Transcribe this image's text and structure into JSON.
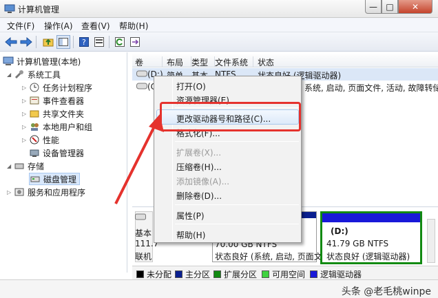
{
  "window": {
    "title": "计算机管理",
    "controls": {
      "minimize": "—",
      "maximize": "□",
      "close": "✕"
    }
  },
  "menu": [
    "文件(F)",
    "操作(A)",
    "查看(V)",
    "帮助(H)"
  ],
  "tree": {
    "root": "计算机管理(本地)",
    "system_tools": "系统工具",
    "system_children": [
      "任务计划程序",
      "事件查看器",
      "共享文件夹",
      "本地用户和组",
      "性能",
      "设备管理器"
    ],
    "storage": "存储",
    "disk_mgmt": "磁盘管理",
    "services": "服务和应用程序"
  },
  "columns": [
    "卷",
    "布局",
    "类型",
    "文件系统",
    "状态"
  ],
  "volumes": [
    {
      "vol": "(D:)",
      "layout": "简单",
      "type": "基本",
      "fs": "NTFS",
      "status": "状态良好 (逻辑驱动器)"
    },
    {
      "vol": "(C",
      "layout": "",
      "type": "",
      "fs": "",
      "status": "系统, 启动, 页面文件, 活动, 故障转储, 主"
    }
  ],
  "context_menu": {
    "items": [
      "打开(O)",
      "资源管理器(E)",
      "更改驱动器号和路径(C)...",
      "格式化(F)...",
      "扩展卷(X)...",
      "压缩卷(H)...",
      "添加镜像(A)...",
      "删除卷(D)...",
      "属性(P)",
      "帮助(H)"
    ],
    "disabled": [
      "扩展卷(X)...",
      "添加镜像(A)..."
    ]
  },
  "disk": {
    "label_line1": "基本",
    "label_line2": "111.7",
    "label_line3": "联机",
    "partition_c_size": "70.00 GB NTFS",
    "partition_c_status": "状态良好 (系统, 启动, 页面文",
    "partition_d_name": "(D:)",
    "partition_d_size": "41.79 GB NTFS",
    "partition_d_status": "状态良好 (逻辑驱动器)"
  },
  "legend": [
    {
      "label": "未分配",
      "color": "#000000"
    },
    {
      "label": "主分区",
      "color": "#0a1f8f"
    },
    {
      "label": "扩展分区",
      "color": "#128a12"
    },
    {
      "label": "可用空间",
      "color": "#3fd23f"
    },
    {
      "label": "逻辑驱动器",
      "color": "#1919d9"
    }
  ],
  "watermark": "头条 @老毛桃winpe",
  "colors": {
    "highlight_box": "#e5322d",
    "arrow": "#e5322d"
  }
}
